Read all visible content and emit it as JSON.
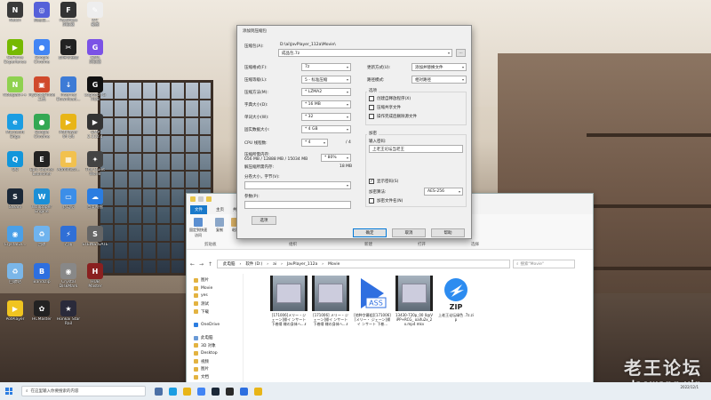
{
  "desktop_icons": [
    {
      "label": "Netch",
      "color": "#3a3a3a",
      "glyph": "N"
    },
    {
      "label": "网易云...",
      "color": "#5560d9",
      "glyph": "◎"
    },
    {
      "label": "FastMoss\n浏览器",
      "color": "#333333",
      "glyph": "F"
    },
    {
      "label": "IVT\n截图",
      "color": "#eeeeee",
      "glyph": "✎"
    },
    {
      "label": "GeForce\nExperience",
      "color": "#76b900",
      "glyph": "▶"
    },
    {
      "label": "Google\nChrome",
      "color": "#4285f4",
      "glyph": "●"
    },
    {
      "label": "剪映专业版",
      "color": "#222222",
      "glyph": "✂"
    },
    {
      "label": "GMA\n浏览器",
      "color": "#7b52e6",
      "glyph": "G"
    },
    {
      "label": "Notepad++",
      "color": "#8fd14f",
      "glyph": "N"
    },
    {
      "label": "MyDockFinder\n工具",
      "color": "#d04a2c",
      "glyph": "▣"
    },
    {
      "label": "Internet\nDownload...",
      "color": "#3d7bd6",
      "glyph": "↓"
    },
    {
      "label": "Logitech G\nHUB",
      "color": "#111111",
      "glyph": "G"
    },
    {
      "label": "Microsoft\nEdge",
      "color": "#1b9de2",
      "glyph": "e"
    },
    {
      "label": "Google\nChrome",
      "color": "#34a853",
      "glyph": "●"
    },
    {
      "label": "PotPlayer\n64 bit",
      "color": "#e8b518",
      "glyph": "▶"
    },
    {
      "label": "GMP\n2.112.4",
      "color": "#333333",
      "glyph": "▶"
    },
    {
      "label": "QQ",
      "color": "#1296db",
      "glyph": "Q"
    },
    {
      "label": "Epic Games\nLauncher",
      "color": "#222222",
      "glyph": "E"
    },
    {
      "label": "Administr...",
      "color": "#f2c14e",
      "glyph": "▦"
    },
    {
      "label": "The Quiet\nWorld",
      "color": "#444444",
      "glyph": "✦"
    },
    {
      "label": "Steam",
      "color": "#1b2838",
      "glyph": "S"
    },
    {
      "label": "Wallpaper\nEngine",
      "color": "#1c8fd6",
      "glyph": "W"
    },
    {
      "label": "此电脑",
      "color": "#3c8ee8",
      "glyph": "▭"
    },
    {
      "label": "百度网盘",
      "color": "#2b7de1",
      "glyph": "☁"
    },
    {
      "label": "CrystalDi...",
      "color": "#4aa0e8",
      "glyph": "◉"
    },
    {
      "label": "回收",
      "color": "#6fb3ee",
      "glyph": "♻"
    },
    {
      "label": "迅雷",
      "color": "#2f6fd6",
      "glyph": "⚡"
    },
    {
      "label": "STEINS;GATE",
      "color": "#666666",
      "glyph": "S"
    },
    {
      "label": "回收站",
      "color": "#7ab6e8",
      "glyph": "♻"
    },
    {
      "label": "Bandizip",
      "color": "#2d6fe0",
      "glyph": "B"
    },
    {
      "label": "Crystal\nDiskMark",
      "color": "#888888",
      "glyph": "◉"
    },
    {
      "label": "HUB\nMaster",
      "color": "#8a2020",
      "glyph": "H"
    },
    {
      "label": "PotPlayer",
      "color": "#f0c420",
      "glyph": "▶"
    },
    {
      "label": "HCMaster",
      "color": "#222222",
      "glyph": "✿"
    },
    {
      "label": "Honkai Star\nRail",
      "color": "#2a2a3a",
      "glyph": "★"
    }
  ],
  "explorer": {
    "tabs": [
      "文件",
      "主页",
      "共享",
      "查看"
    ],
    "ribbon_buttons": [
      "固定到快速访问",
      "复制",
      "粘贴"
    ],
    "ribbon_groups": [
      "剪贴板",
      "组织",
      "新建",
      "打开",
      "选择"
    ],
    "path": [
      "此电脑",
      "软件 (D:)",
      "ai",
      "JavPlayer_112a",
      "Movie"
    ],
    "search_placeholder": "搜索\"Movie\"",
    "nav_items": [
      "图片",
      "Movie",
      "yes",
      "测试",
      "下载",
      "OneDrive",
      "此电脑",
      "3D 对象",
      "Desktop",
      "视频",
      "图片",
      "文档"
    ],
    "files": [
      {
        "name": "[171006]メリー・ジェーン]帰イ ンサート下巻帰 様の身体へ…ℓ",
        "type": "video"
      },
      {
        "name": "[171006] メリー・ジェーン]帰イ ンサート下巻帰 様の身体へ…ℓ",
        "type": "video"
      },
      {
        "name": "[他种字幕组][171006][メリー・ ジェーン]帰イ ンサート 下巻…",
        "type": "ass"
      },
      {
        "name": "13430-720p_00 0@ViPP+RCG_ oaifu2x_2x.mp4 mkv",
        "type": "video"
      },
      {
        "name": "上老王论坛绿色 .7z.zip",
        "type": "zip"
      }
    ]
  },
  "zip_dialog": {
    "title": "添加到压缩包",
    "archive_label": "压缩包(A):",
    "archive_dir": "D:\\ai\\JavPlayer_112a\\Movie\\",
    "archive_name": "成品包.7z",
    "browse": "...",
    "format_label": "压缩格式(F):",
    "format": "7z",
    "level_label": "压缩等级(L):",
    "level": "5 - 标准压缩",
    "method_label": "压缩方法(M):",
    "method": "* LZMA2",
    "dict_label": "字典大小(D):",
    "dict": "* 16 MB",
    "word_label": "单词大小(W):",
    "word": "* 32",
    "solid_label": "固实数据大小:",
    "solid": "* 4 GB",
    "threads_label": "CPU 线程数:",
    "threads": "* 4",
    "threads_max": "/ 4",
    "memory_label": "压缩所需内存:",
    "memory_detail": "656 MB / 12888 MB / 15034 MB",
    "memory_percent": "* 80%",
    "decompress_label": "解压缩所需内存:",
    "decompress_val": "18 MB",
    "split_label": "分卷大小，字节(V):",
    "params_label": "参数(P):",
    "options_button": "选项",
    "update_label": "更新方式(U):",
    "update_mode": "添加并替换文件",
    "path_mode_label": "路径模式:",
    "path_mode": "相对路径",
    "options_group": "选项",
    "opt_sfx": "创建自释放程序(X)",
    "opt_shared": "压缩共享文件",
    "opt_delete": "操作完成后删除源文件",
    "encrypt_group": "加密",
    "pwd_label": "输入密码:",
    "pwd_value": "上老王论坛当老王",
    "show_pwd": "显示密码(S)",
    "enc_method_label": "加密算法:",
    "enc_method": "AES-256",
    "encrypt_names": "加密文件名(N)",
    "ok": "确定",
    "cancel": "取消",
    "help": "帮助"
  },
  "taskbar": {
    "search_placeholder": "在这里输入你要搜索的内容",
    "time": "",
    "date": "2022/12/1"
  },
  "watermark": {
    "line1": "老王论坛",
    "line2": "laowang.vip"
  }
}
